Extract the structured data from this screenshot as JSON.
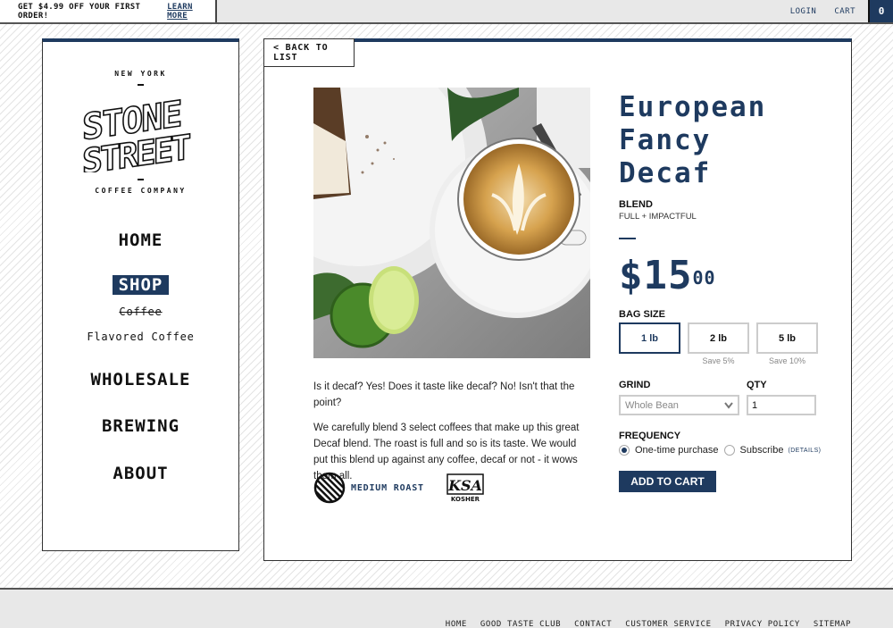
{
  "topbar": {
    "promo_text": "GET $4.99 OFF YOUR FIRST ORDER!",
    "promo_link": "LEARN MORE",
    "login": "LOGIN",
    "cart": "CART",
    "cart_count": "0"
  },
  "brand": {
    "city": "NEW YORK",
    "name_line1": "STONE",
    "name_line2": "STREET",
    "subtitle": "COFFEE COMPANY"
  },
  "sidebar": {
    "items": [
      {
        "label": "HOME"
      },
      {
        "label": "SHOP",
        "active": true
      },
      {
        "label": "Coffee",
        "sub": true,
        "struck": true
      },
      {
        "label": "Flavored Coffee",
        "sub": true
      },
      {
        "label": "WHOLESALE"
      },
      {
        "label": "BREWING"
      },
      {
        "label": "ABOUT"
      }
    ]
  },
  "main": {
    "back_label": "< BACK TO LIST",
    "image_alt": "Latte with leaf art beside cake and limes",
    "description": [
      "Is it decaf? Yes! Does it taste like decaf? No! Isn't that the point?",
      "We carefully blend 3 select coffees that make up this great Decaf blend. The roast is full and so is its taste. We would put this blend up against any coffee, decaf or not - it wows them all."
    ],
    "roast_label": "MEDIUM ROAST",
    "kosher_top": "KSA",
    "kosher_bottom": "KOSHER"
  },
  "product": {
    "title_line1": "European",
    "title_line2": "Fancy",
    "title_line3": "Decaf",
    "type": "BLEND",
    "tagline": "FULL + IMPACTFUL",
    "price_dollars": "$15",
    "price_cents": "00",
    "bag_size_label": "BAG SIZE",
    "sizes": [
      {
        "label": "1 lb",
        "note": "",
        "selected": true
      },
      {
        "label": "2 lb",
        "note": "Save 5%"
      },
      {
        "label": "5 lb",
        "note": "Save 10%"
      }
    ],
    "grind_label": "GRIND",
    "grind_value": "Whole Bean",
    "qty_label": "QTY",
    "qty_value": "1",
    "frequency_label": "FREQUENCY",
    "frequency_options": [
      {
        "label": "One-time purchase",
        "checked": true
      },
      {
        "label": "Subscribe",
        "checked": false
      }
    ],
    "details_link": "(DETAILS)",
    "add_to_cart": "ADD TO CART"
  },
  "colors": {
    "brand_navy": "#1e3a5f"
  },
  "footer": {
    "links": [
      "HOME",
      "GOOD TASTE CLUB",
      "CONTACT",
      "CUSTOMER SERVICE",
      "PRIVACY POLICY",
      "SITEMAP"
    ]
  }
}
